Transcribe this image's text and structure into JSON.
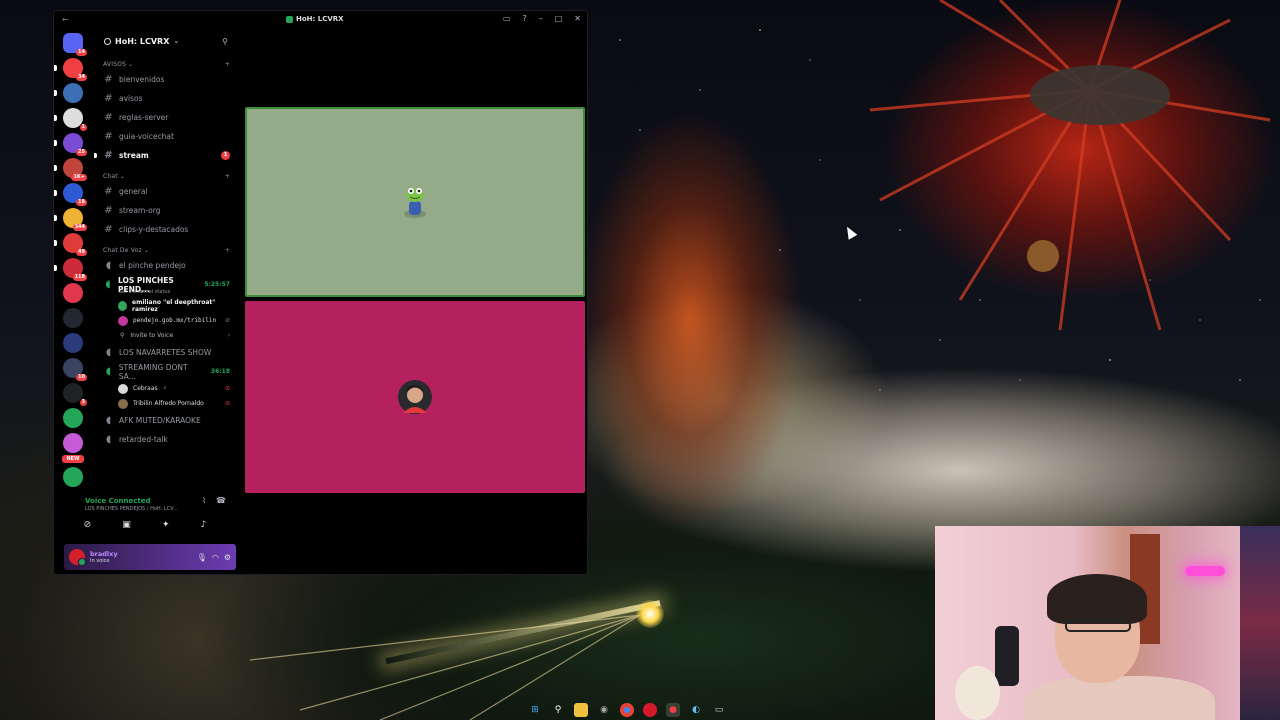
{
  "window": {
    "title": "HoH: LCVRX"
  },
  "guilds": [
    {
      "color": "#5865f2",
      "badge": "14"
    },
    {
      "color": "#f23f43",
      "badge": "34"
    },
    {
      "color": "#3b6fb6",
      "badge": ""
    },
    {
      "color": "#dddddd",
      "badge": "1"
    },
    {
      "color": "#7b4bd6",
      "badge": "25"
    },
    {
      "color": "#c2453d",
      "badge": "1K+"
    },
    {
      "color": "#2e5bd3",
      "badge": "18"
    },
    {
      "color": "#f0b232",
      "badge": "344"
    },
    {
      "color": "#e03a3a",
      "badge": "49"
    },
    {
      "color": "#cc2b3a",
      "badge": "118"
    },
    {
      "color": "#e2364d",
      "badge": ""
    },
    {
      "color": "#222831",
      "badge": ""
    },
    {
      "color": "#2a3a7a",
      "badge": ""
    },
    {
      "color": "#3a4460",
      "badge": "10"
    },
    {
      "color": "#202225",
      "badge": "3"
    },
    {
      "color": "#23a55a",
      "badge": ""
    },
    {
      "color": "#c55bd6",
      "badge": ""
    },
    {
      "color": "#23a55a",
      "badge": ""
    }
  ],
  "new_tag": "NEW",
  "server": {
    "name": "HoH: LCVRX",
    "categories": {
      "avisos": "AVISOS",
      "chat": "Chat",
      "voz": "Chat De Voz"
    },
    "text_channels_avisos": [
      "bienvenidos",
      "avisos",
      "reglas-server",
      "guia-voicechat"
    ],
    "stream_channel": {
      "name": "stream",
      "unread": "1"
    },
    "text_channels_chat": [
      "general",
      "stream-org",
      "clips-y-destacados"
    ],
    "voice": {
      "ch1": "el pinche pendejo",
      "ch2": {
        "name": "LOS PINCHES PEND...",
        "time": "5:25:57",
        "status": "Set a channel status"
      },
      "ch2_members": [
        "emiliano \"el deepthroat\" ramirez",
        "pendejo.gob.mx/tribilin"
      ],
      "invite": "Invite to Voice",
      "ch3": "LOS NAVARRETES SHOW",
      "ch4": {
        "name": "STREAMING DONT SA...",
        "time": "36:18"
      },
      "ch4_members": [
        "Cebraas",
        "Tribilin Alfredo Pornaldo"
      ],
      "ch5": "AFK MUTED/KARAOKE",
      "ch6": "retarded-talk"
    }
  },
  "voice_connected": {
    "title": "Voice Connected",
    "subtitle": "LOS PINCHES PENDEJOS / HoH: LCV..."
  },
  "user": {
    "name": "bradlxy",
    "status": "In voice"
  },
  "colors": {
    "tile_top": "#95aa88",
    "tile_bottom": "#b5205f",
    "accent_green": "#23a55a",
    "unread_red": "#f23f43"
  }
}
